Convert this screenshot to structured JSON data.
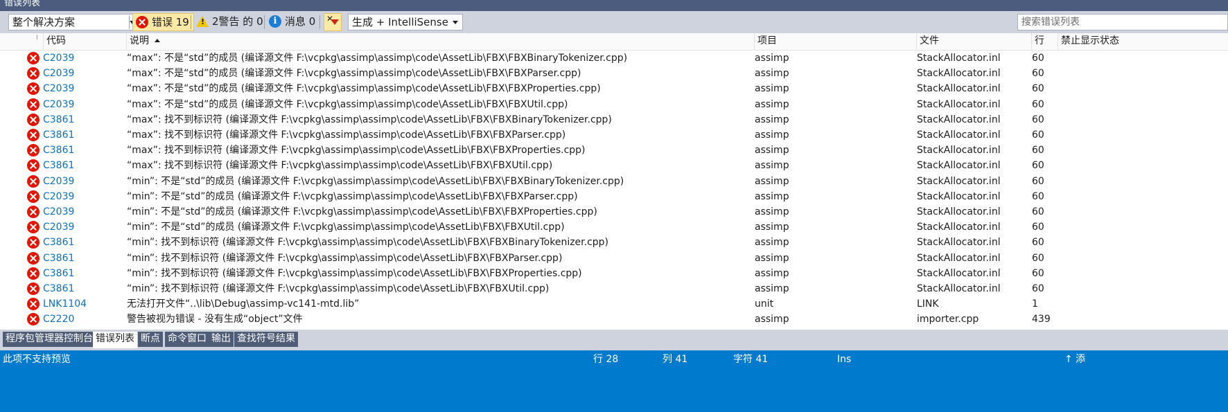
{
  "window": {
    "title": "错误列表"
  },
  "toolbar": {
    "scope": "整个解决方案",
    "errors_label": "错误 19",
    "warnings_label": "2警告 的 0",
    "messages_label": "消息 0",
    "build_filter": "生成 + IntelliSense",
    "search_placeholder": "搜索错误列表"
  },
  "columns": {
    "code": "代码",
    "description": "说明",
    "project": "项目",
    "file": "文件",
    "line": "行",
    "suppress": "禁止显示状态"
  },
  "errors": [
    {
      "code": "C2039",
      "description": "“max”: 不是“std”的成员 (编译源文件 F:\\vcpkg\\assimp\\assimp\\code\\AssetLib\\FBX\\FBXBinaryTokenizer.cpp)",
      "project": "assimp",
      "file": "StackAllocator.inl",
      "line": "60"
    },
    {
      "code": "C2039",
      "description": "“max”: 不是“std”的成员 (编译源文件 F:\\vcpkg\\assimp\\assimp\\code\\AssetLib\\FBX\\FBXParser.cpp)",
      "project": "assimp",
      "file": "StackAllocator.inl",
      "line": "60"
    },
    {
      "code": "C2039",
      "description": "“max”: 不是“std”的成员 (编译源文件 F:\\vcpkg\\assimp\\assimp\\code\\AssetLib\\FBX\\FBXProperties.cpp)",
      "project": "assimp",
      "file": "StackAllocator.inl",
      "line": "60"
    },
    {
      "code": "C2039",
      "description": "“max”: 不是“std”的成员 (编译源文件 F:\\vcpkg\\assimp\\assimp\\code\\AssetLib\\FBX\\FBXUtil.cpp)",
      "project": "assimp",
      "file": "StackAllocator.inl",
      "line": "60"
    },
    {
      "code": "C3861",
      "description": "“max”: 找不到标识符 (编译源文件 F:\\vcpkg\\assimp\\assimp\\code\\AssetLib\\FBX\\FBXBinaryTokenizer.cpp)",
      "project": "assimp",
      "file": "StackAllocator.inl",
      "line": "60"
    },
    {
      "code": "C3861",
      "description": "“max”: 找不到标识符 (编译源文件 F:\\vcpkg\\assimp\\assimp\\code\\AssetLib\\FBX\\FBXParser.cpp)",
      "project": "assimp",
      "file": "StackAllocator.inl",
      "line": "60"
    },
    {
      "code": "C3861",
      "description": "“max”: 找不到标识符 (编译源文件 F:\\vcpkg\\assimp\\assimp\\code\\AssetLib\\FBX\\FBXProperties.cpp)",
      "project": "assimp",
      "file": "StackAllocator.inl",
      "line": "60"
    },
    {
      "code": "C3861",
      "description": "“max”: 找不到标识符 (编译源文件 F:\\vcpkg\\assimp\\assimp\\code\\AssetLib\\FBX\\FBXUtil.cpp)",
      "project": "assimp",
      "file": "StackAllocator.inl",
      "line": "60"
    },
    {
      "code": "C2039",
      "description": "“min”: 不是“std”的成员 (编译源文件 F:\\vcpkg\\assimp\\assimp\\code\\AssetLib\\FBX\\FBXBinaryTokenizer.cpp)",
      "project": "assimp",
      "file": "StackAllocator.inl",
      "line": "60"
    },
    {
      "code": "C2039",
      "description": "“min”: 不是“std”的成员 (编译源文件 F:\\vcpkg\\assimp\\assimp\\code\\AssetLib\\FBX\\FBXParser.cpp)",
      "project": "assimp",
      "file": "StackAllocator.inl",
      "line": "60"
    },
    {
      "code": "C2039",
      "description": "“min”: 不是“std”的成员 (编译源文件 F:\\vcpkg\\assimp\\assimp\\code\\AssetLib\\FBX\\FBXProperties.cpp)",
      "project": "assimp",
      "file": "StackAllocator.inl",
      "line": "60"
    },
    {
      "code": "C2039",
      "description": "“min”: 不是“std”的成员 (编译源文件 F:\\vcpkg\\assimp\\assimp\\code\\AssetLib\\FBX\\FBXUtil.cpp)",
      "project": "assimp",
      "file": "StackAllocator.inl",
      "line": "60"
    },
    {
      "code": "C3861",
      "description": "“min”: 找不到标识符 (编译源文件 F:\\vcpkg\\assimp\\assimp\\code\\AssetLib\\FBX\\FBXBinaryTokenizer.cpp)",
      "project": "assimp",
      "file": "StackAllocator.inl",
      "line": "60"
    },
    {
      "code": "C3861",
      "description": "“min”: 找不到标识符 (编译源文件 F:\\vcpkg\\assimp\\assimp\\code\\AssetLib\\FBX\\FBXParser.cpp)",
      "project": "assimp",
      "file": "StackAllocator.inl",
      "line": "60"
    },
    {
      "code": "C3861",
      "description": "“min”: 找不到标识符 (编译源文件 F:\\vcpkg\\assimp\\assimp\\code\\AssetLib\\FBX\\FBXProperties.cpp)",
      "project": "assimp",
      "file": "StackAllocator.inl",
      "line": "60"
    },
    {
      "code": "C3861",
      "description": "“min”: 找不到标识符 (编译源文件 F:\\vcpkg\\assimp\\assimp\\code\\AssetLib\\FBX\\FBXUtil.cpp)",
      "project": "assimp",
      "file": "StackAllocator.inl",
      "line": "60"
    },
    {
      "code": "LNK1104",
      "description": "无法打开文件“..\\lib\\Debug\\assimp-vc141-mtd.lib”",
      "project": "unit",
      "file": "LINK",
      "line": "1"
    },
    {
      "code": "C2220",
      "description": "警告被视为错误 - 没有生成“object”文件",
      "project": "assimp",
      "file": "importer.cpp",
      "line": "439"
    }
  ],
  "tabs": [
    "程序包管理器控制台",
    "错误列表",
    "断点",
    "命令窗口",
    "输出",
    "查找符号结果"
  ],
  "status": {
    "left": "此项不支持预览",
    "line": "行 28",
    "col": "列 41",
    "char": "字符 41",
    "mode": "Ins",
    "right": "↑ 添"
  },
  "colors": {
    "accent": "#007acc",
    "title_bar": "#4b5c7f",
    "error_icon": "#e51400",
    "link": "#0e70c0",
    "toolbar_bg": "#ced3de",
    "pressed_bg": "#fbe9a6"
  },
  "icons": {
    "errors": "error-icon",
    "warnings": "warning-icon",
    "messages": "info-icon",
    "filter": "filter-icon"
  }
}
